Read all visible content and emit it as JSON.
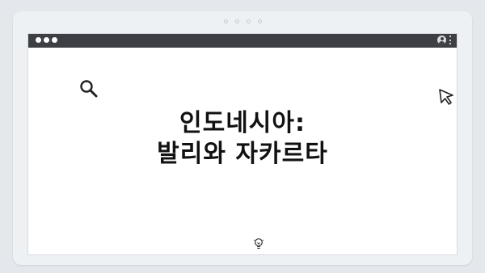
{
  "window": {
    "traffic_lights": [
      "close",
      "minimize",
      "maximize"
    ],
    "icons": [
      "profile-icon",
      "kebab-menu-icon"
    ]
  },
  "page": {
    "title_line_1": "인도네시아:",
    "title_line_2": "발리와 자카르타",
    "decorations": [
      "magnifier-icon",
      "cursor-arrow-icon",
      "lightbulb-icon"
    ]
  },
  "colors": {
    "background": "#e4e8ec",
    "titlebar": "#3d3f44",
    "content": "#ffffff",
    "text": "#111111"
  }
}
